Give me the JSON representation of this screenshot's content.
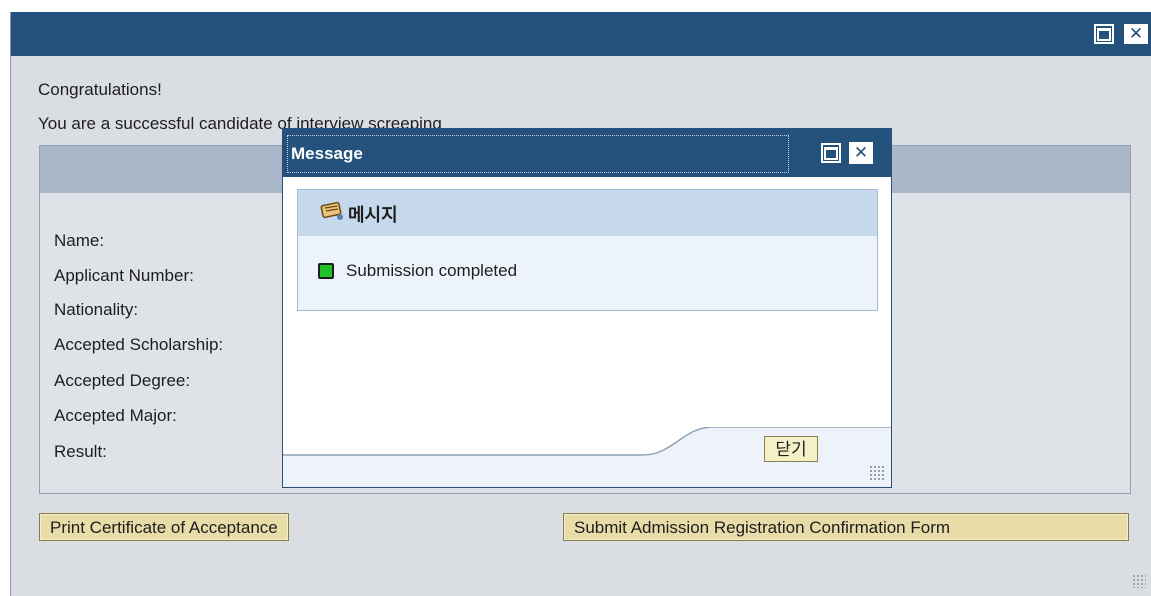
{
  "main_window": {
    "congrats": "Congratulations!",
    "subtitle": "You are a successful candidate of interview screeping",
    "fields": [
      {
        "label": "Name:"
      },
      {
        "label": "Applicant Number:"
      },
      {
        "label": "Nationality:"
      },
      {
        "label": "Accepted Scholarship:"
      },
      {
        "label": "Accepted Degree:"
      },
      {
        "label": "Accepted Major:"
      },
      {
        "label": "Result:"
      }
    ],
    "print_button": "Print Certificate of Acceptance",
    "submit_button": "Submit Admission Registration Confirmation Form"
  },
  "dialog": {
    "title": "Message",
    "header_label": "메시지",
    "message": "Submission completed",
    "close_button": "닫기"
  },
  "icons": {
    "window_maximize": "maximize-icon",
    "window_close": "close-icon",
    "message_header": "message-icon",
    "status": "success-status-icon"
  },
  "colors": {
    "titlebar": "#25527c",
    "button": "#e8dca8",
    "status_ok": "#22c22a"
  }
}
